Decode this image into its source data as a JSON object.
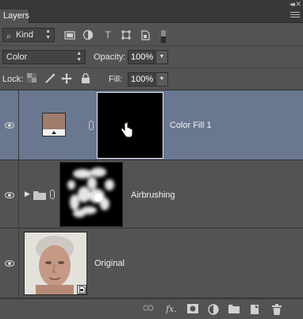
{
  "panel": {
    "tab_label": "Layers"
  },
  "filter": {
    "kind_label": "Kind"
  },
  "options": {
    "blend_mode": "Color",
    "opacity_label": "Opacity:",
    "opacity_value": "100%",
    "lock_label": "Lock:",
    "fill_label": "Fill:",
    "fill_value": "100%"
  },
  "layers": [
    {
      "name": "Color Fill 1",
      "selected": true,
      "swatch_color": "#a07c6c"
    },
    {
      "name": "Airbrushing",
      "selected": false
    },
    {
      "name": "Original",
      "selected": false
    }
  ],
  "bottom": {
    "fx_label": "fx."
  }
}
